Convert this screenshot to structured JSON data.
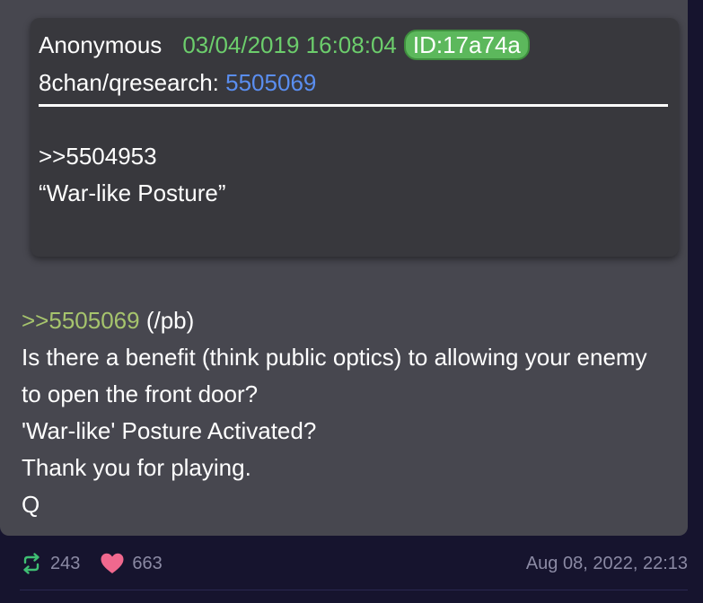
{
  "quoted_post": {
    "author": "Anonymous",
    "timestamp": "03/04/2019 16:08:04",
    "id_badge": "ID:17a74a",
    "board_label": "8chan/qresearch:",
    "post_number": "5505069",
    "lines": [
      ">>5504953",
      "“War-like Posture”"
    ]
  },
  "reply": {
    "link": ">>5505069",
    "link_suffix": " (/pb)",
    "lines": [
      "Is there a benefit (think public optics) to allowing your enemy",
      "to open the front door?",
      "'War-like' Posture Activated?",
      "Thank you for playing.",
      "Q"
    ]
  },
  "footer": {
    "reposts": "243",
    "likes": "663",
    "date": "Aug 08, 2022, 22:13"
  },
  "colors": {
    "background": "#16142e",
    "card": "#47474f",
    "quoted_card": "#38383d",
    "timestamp_green": "#6ccd6c",
    "id_badge_green": "#5cb85c",
    "board_link_blue": "#5a8ef0",
    "reply_link_green": "#a6c46d",
    "repost_icon_green": "#3fbf73",
    "heart_icon_pink": "#f0688e",
    "muted_text": "#8b8aa4"
  },
  "icons": {
    "repost": "repost-icon",
    "like": "heart-icon"
  }
}
